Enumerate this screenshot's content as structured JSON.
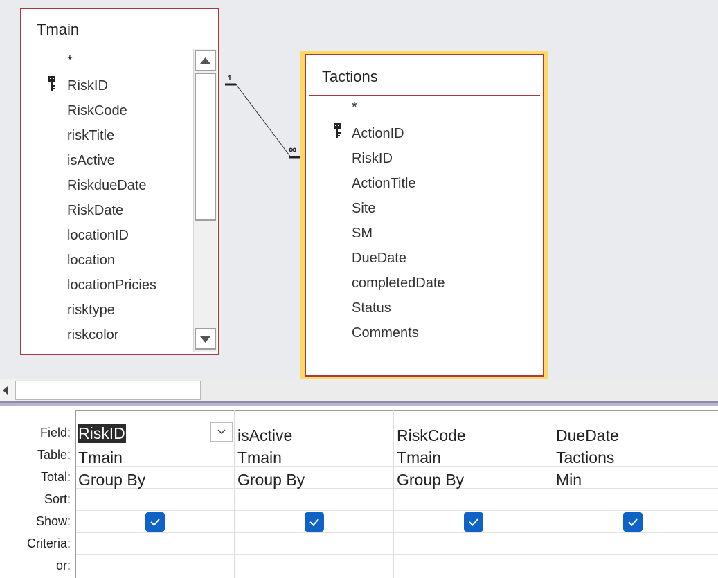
{
  "tmain": {
    "title": "Tmain",
    "fields": [
      "*",
      "RiskID",
      "RiskCode",
      "riskTitle",
      "isActive",
      "RiskdueDate",
      "RiskDate",
      "locationID",
      "location",
      "locationPricies",
      "risktype",
      "riskcolor"
    ]
  },
  "tactions": {
    "title": "Tactions",
    "fields": [
      "*",
      "ActionID",
      "RiskID",
      "ActionTitle",
      "Site",
      "SM",
      "DueDate",
      "completedDate",
      "Status",
      "Comments"
    ]
  },
  "relationship": {
    "one_label": "1",
    "many_label": "∞"
  },
  "grid": {
    "row_labels": {
      "field": "Field:",
      "table": "Table:",
      "total": "Total:",
      "sort": "Sort:",
      "show": "Show:",
      "criteria": "Criteria:",
      "or": "or:"
    },
    "columns": [
      {
        "field": "RiskID",
        "table": "Tmain",
        "total": "Group By",
        "show": true
      },
      {
        "field": "isActive",
        "table": "Tmain",
        "total": "Group By",
        "show": true
      },
      {
        "field": "RiskCode",
        "table": "Tmain",
        "total": "Group By",
        "show": true
      },
      {
        "field": "DueDate",
        "table": "Tactions",
        "total": "Min",
        "show": true
      }
    ]
  },
  "colors": {
    "table_border": "#a8383b",
    "selected_halo": "#ffd966",
    "checkbox": "#1063c6",
    "design_bg": "#e9ebee"
  },
  "icons": {
    "primary_key": "key-icon",
    "dropdown": "chevron-down-icon",
    "checkbox": "check-icon",
    "scroll_up": "triangle-up-icon",
    "scroll_down": "triangle-down-icon",
    "scroll_left": "triangle-left-icon"
  }
}
